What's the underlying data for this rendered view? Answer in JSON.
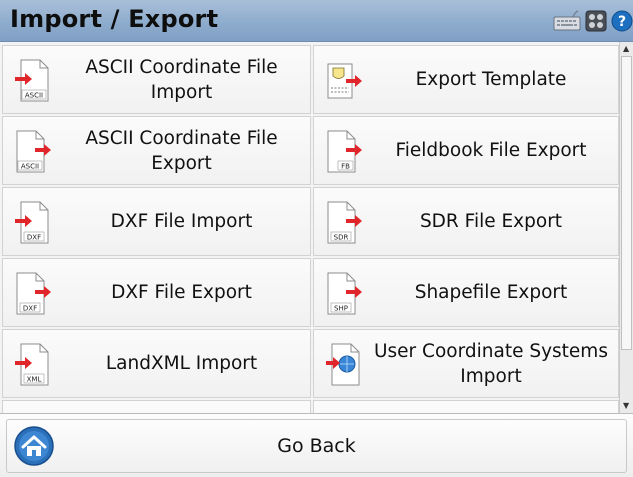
{
  "window": {
    "title": "Import / Export"
  },
  "toolbar": {
    "icons": [
      "keyboard-icon",
      "gps-status-icon",
      "help-icon"
    ],
    "help_glyph": "?"
  },
  "menu": {
    "items": [
      {
        "label": "ASCII Coordinate File Import",
        "icon": "ascii-import-icon",
        "badge": "ASCII"
      },
      {
        "label": "Export Template",
        "icon": "template-export-icon",
        "badge": ""
      },
      {
        "label": "ASCII Coordinate File Export",
        "icon": "ascii-export-icon",
        "badge": "ASCII"
      },
      {
        "label": "Fieldbook File Export",
        "icon": "fieldbook-export-icon",
        "badge": "FB"
      },
      {
        "label": "DXF File Import",
        "icon": "dxf-import-icon",
        "badge": "DXF"
      },
      {
        "label": "SDR File Export",
        "icon": "sdr-export-icon",
        "badge": "SDR"
      },
      {
        "label": "DXF File Export",
        "icon": "dxf-export-icon",
        "badge": "DXF"
      },
      {
        "label": "Shapefile Export",
        "icon": "shapefile-export-icon",
        "badge": "SHP"
      },
      {
        "label": "LandXML Import",
        "icon": "landxml-import-icon",
        "badge": "XML"
      },
      {
        "label": "User Coordinate Systems Import",
        "icon": "coordinate-systems-import-icon",
        "badge": ""
      }
    ]
  },
  "footer": {
    "go_back_label": "Go Back"
  },
  "colors": {
    "titlebar": "#8eaccd",
    "arrow_red": "#e0262b",
    "home_blue": "#2a6fb8"
  }
}
